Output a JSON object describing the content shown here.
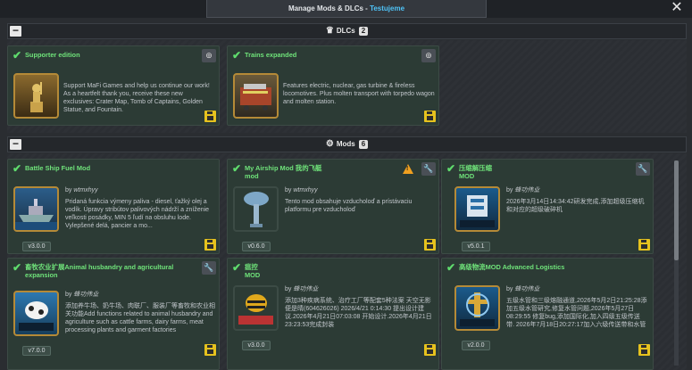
{
  "window": {
    "title": "Manage Mods & DLCs",
    "separator": " - ",
    "project": "Testujeme",
    "close": "✕"
  },
  "dlcs": {
    "collapse_label": "−",
    "title": "DLCs",
    "count": "2",
    "items": [
      {
        "title": "Supporter edition",
        "description": "Support MaFi Games and help us continue our work! As a heartfelt thank you, receive these new exclusives: Crater Map, Tomb of Captains, Golden Statue, and Fountain.",
        "corner_icon": "steam-icon"
      },
      {
        "title": "Trains expanded",
        "description": "Features electric, nuclear, gas turbine & fireless locomotives. Plus molten transport with torpedo wagon and molten station.",
        "corner_icon": "steam-icon"
      }
    ]
  },
  "mods": {
    "collapse_label": "−",
    "title": "Mods",
    "count": "6",
    "items": [
      {
        "title": "Battle Ship Fuel Mod",
        "subtitle": "",
        "author_prefix": "by",
        "author": "wtmxhyy",
        "description": "Pridaná funkcia výmeny paliva - diesel, ťažký olej a vodík. Úpravy stribútov palivových nádrží a zníženie veľkosti posádky, MIN 5 ľudí na obsluhu lode. Vylepšené delá, pancier a mo...",
        "version": "v3.0.0"
      },
      {
        "title": "My Airship Mod 我的飞艇",
        "subtitle": "mod",
        "author_prefix": "by",
        "author": "wtmxhyy",
        "description": "Tento mod obsahuje vzducholoď a prístávaciu platformu pre vzducholoď",
        "version": "v0.6.0"
      },
      {
        "title": "压缩解压缩",
        "subtitle": "MOD",
        "author_prefix": "by",
        "author": "蜂功伟业",
        "description": "2026年3月14日14:34:42研发完成,添加超级压缩机和对应的超级破碎机",
        "version": "v5.0.1"
      },
      {
        "title": "畜牧农业扩展Animal husbandry and agricultural expansion",
        "subtitle": "",
        "author_prefix": "by",
        "author": "蜂功伟业",
        "description": "添加养牛场、奶牛场、肉联厂、服装厂等畜牧和农业相关功能Add functions related to animal husbandry and agriculture such as cattle farms, dairy farms, meat processing plants and garment factories",
        "version": "v7.0.0"
      },
      {
        "title": "瘟控",
        "subtitle": "MOD",
        "author_prefix": "by",
        "author": "蜂功伟业",
        "description": "添加3种疾病系统、治疗工厂等配套5种法案 天空无影便是晴(604626026) 2026/4/21 0:14:30 提出设计建议.2026年4月21日07:03:08 开始设计.2026年4月21日23:23:53完成封装",
        "version": "v3.0.0"
      },
      {
        "title": "高级物流MOD Advanced Logistics",
        "subtitle": "",
        "author_prefix": "by",
        "author": "蜂功伟业",
        "description": "五级水管和三级熔融通道,2026年5月2日21:25:28添加五级水管研究,修复水管问题,2026年5月27日08:29:55 修复bug,添加国际化,加入四级五级传送带. 2026年7月18日20:27:17加入六级传送带和水管",
        "version": "v2.0.0"
      }
    ]
  },
  "colors": {
    "accent_green": "#6fe37a",
    "save_yellow": "#e6c21e",
    "warning_orange": "#f0a020",
    "project_blue": "#4fc3f7"
  }
}
